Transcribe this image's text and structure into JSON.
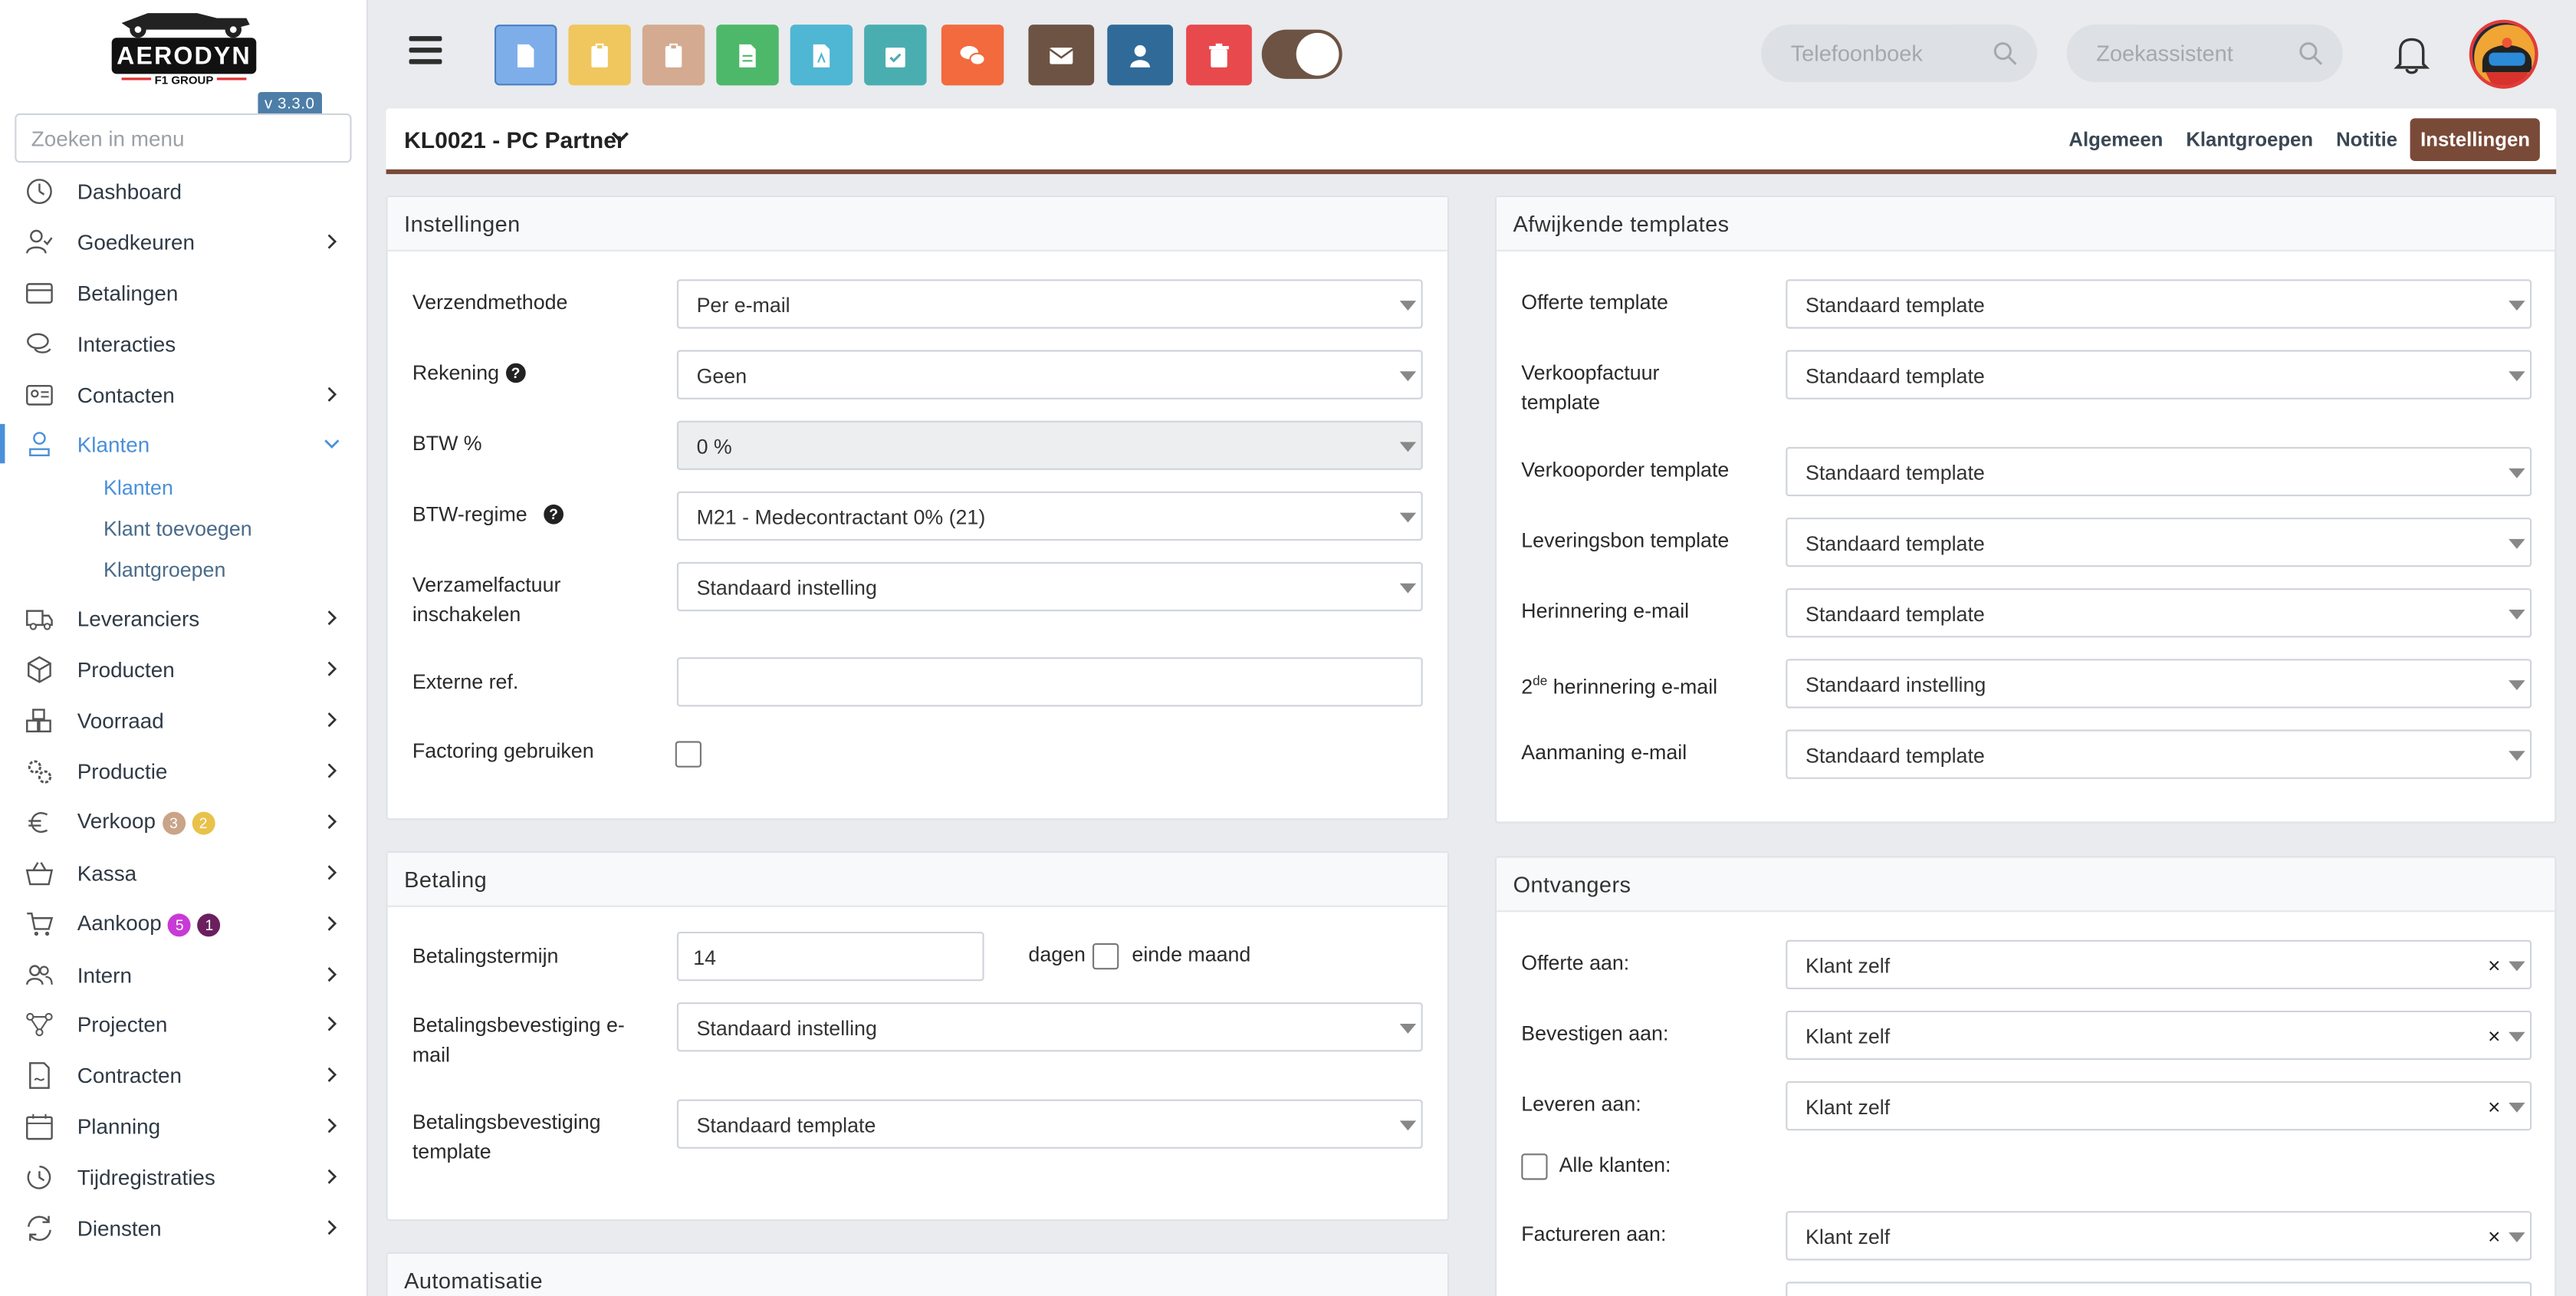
{
  "app": {
    "logo_text": "AERODYN",
    "logo_sub": "F1 GROUP",
    "version": "v 3.3.0",
    "menu_search_placeholder": "Zoeken in menu"
  },
  "sidebar": {
    "items": [
      {
        "label": "Dashboard",
        "icon": "dashboard-icon"
      },
      {
        "label": "Goedkeuren",
        "icon": "user-check-icon"
      },
      {
        "label": "Betalingen",
        "icon": "credit-card-icon"
      },
      {
        "label": "Interacties",
        "icon": "chat-icon"
      },
      {
        "label": "Contacten",
        "icon": "contact-card-icon"
      },
      {
        "label": "Klanten",
        "icon": "customer-icon"
      },
      {
        "label": "Leveranciers",
        "icon": "truck-icon"
      },
      {
        "label": "Producten",
        "icon": "box-icon"
      },
      {
        "label": "Voorraad",
        "icon": "stock-icon"
      },
      {
        "label": "Productie",
        "icon": "gears-icon"
      },
      {
        "label": "Verkoop",
        "icon": "euro-icon",
        "badges": [
          "3",
          "2"
        ]
      },
      {
        "label": "Kassa",
        "icon": "basket-icon"
      },
      {
        "label": "Aankoop",
        "icon": "cart-icon",
        "badges": [
          "5",
          "1"
        ]
      },
      {
        "label": "Intern",
        "icon": "users-icon"
      },
      {
        "label": "Projecten",
        "icon": "project-icon"
      },
      {
        "label": "Contracten",
        "icon": "contract-icon"
      },
      {
        "label": "Planning",
        "icon": "calendar-icon"
      },
      {
        "label": "Tijdregistraties",
        "icon": "clock-icon"
      },
      {
        "label": "Diensten",
        "icon": "refresh-icon"
      }
    ],
    "sub_items": [
      "Klanten",
      "Klant toevoegen",
      "Klantgroepen"
    ]
  },
  "topbar": {
    "phonebook_placeholder": "Telefoonboek",
    "assistant_placeholder": "Zoekassistent"
  },
  "header": {
    "title": "KL0021 - PC Partner",
    "tabs": [
      "Algemeen",
      "Klantgroepen",
      "Notitie",
      "Instellingen"
    ]
  },
  "instellingen": {
    "title": "Instellingen",
    "verzendmethode_label": "Verzendmethode",
    "verzendmethode_value": "Per e-mail",
    "rekening_label": "Rekening",
    "rekening_value": "Geen",
    "btw_label": "BTW %",
    "btw_value": "0 %",
    "btwregime_label": "BTW-regime",
    "btwregime_value": "M21 - Medecontractant 0% (21)",
    "verzamel_label_1": "Verzamelfactuur",
    "verzamel_label_2": "inschakelen",
    "verzamel_value": "Standaard instelling",
    "externe_label": "Externe ref.",
    "externe_value": "",
    "factoring_label": "Factoring gebruiken"
  },
  "betaling": {
    "title": "Betaling",
    "termijn_label": "Betalingstermijn",
    "termijn_value": "14",
    "dagen": "dagen",
    "einde_maand": "einde maand",
    "bev_email_label_1": "Betalingsbevestiging e-",
    "bev_email_label_2": "mail",
    "bev_email_value": "Standaard instelling",
    "bev_tpl_label_1": "Betalingsbevestiging",
    "bev_tpl_label_2": "template",
    "bev_tpl_value": "Standaard template"
  },
  "automatisatie": {
    "title": "Automatisatie"
  },
  "templates": {
    "title": "Afwijkende templates",
    "offerte_label": "Offerte template",
    "offerte_value": "Standaard template",
    "vkf_label_1": "Verkoopfactuur",
    "vkf_label_2": "template",
    "vkf_value": "Standaard template",
    "vko_label": "Verkooporder template",
    "vko_value": "Standaard template",
    "lev_label": "Leveringsbon template",
    "lev_value": "Standaard template",
    "her_label": "Herinnering e-mail",
    "her_value": "Standaard template",
    "her2_prefix": "2",
    "her2_sup": "de",
    "her2_label": " herinnering e-mail",
    "her2_value": "Standaard instelling",
    "aan_label": "Aanmaning e-mail",
    "aan_value": "Standaard template"
  },
  "ontvangers": {
    "title": "Ontvangers",
    "offerte_label": "Offerte aan:",
    "offerte_value": "Klant zelf",
    "bevestigen_label": "Bevestigen aan:",
    "bevestigen_value": "Klant zelf",
    "leveren_label": "Leveren aan:",
    "leveren_value": "Klant zelf",
    "alle_klanten": "Alle klanten:",
    "factureren_label": "Factureren aan:",
    "factureren_value": "Klant zelf",
    "clear_symbol": "×"
  },
  "colors": {
    "accent": "#7a4a38",
    "active_nav": "#4a90d9",
    "toolbar": [
      "#7eaeea",
      "#f0c75e",
      "#d4ab91",
      "#4db86a",
      "#4fb6d3",
      "#4aaeb0",
      "#f26a3d",
      "#6d5344",
      "#2f6a99",
      "#e8494d"
    ]
  }
}
